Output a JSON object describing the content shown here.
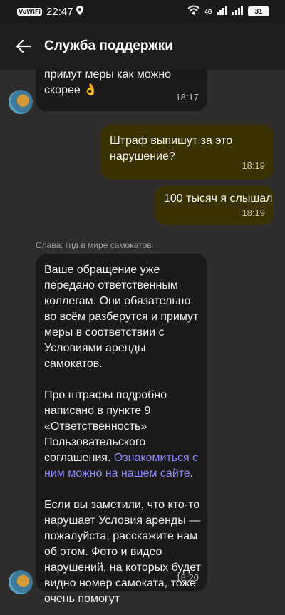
{
  "status": {
    "sim_label": "VoWiFi",
    "time": "22:47",
    "network": "4G",
    "battery": "31"
  },
  "header": {
    "title": "Служба поддержки"
  },
  "messages": {
    "m1": {
      "text": "примут меры как можно скорее 👌",
      "time": "18:17"
    },
    "m2": {
      "text": "Штраф выпишут за это нарушение?",
      "time": "18:19"
    },
    "m3": {
      "text": "100 тысяч я слышал",
      "time": "18:19"
    },
    "sender": "Слава: гид в мире самокатов",
    "m4": {
      "p1": "Ваше обращение уже передано ответственным коллегам. Они обязательно во всём разберутся и примут меры в соответствии с Условиями аренды самокатов.",
      "p2_text": "Про штрафы подробно написано в пункте 9 «Ответственность» Пользовательского соглашения. ",
      "p2_link": "Ознакомиться с ним можно на нашем сайте",
      "p2_end": ".",
      "p3": "Если вы заметили, что кто-то нарушает Условия аренды — пожалуйста, расскажите нам об этом. Фото и видео нарушений, на которых будет видно номер самоката, тоже очень помогут",
      "time": "18:20"
    }
  },
  "colors": {
    "background": "#2e2d2b",
    "incoming_bubble": "#1b1a19",
    "outgoing_bubble": "#3a3200",
    "link": "#8c88ff"
  }
}
